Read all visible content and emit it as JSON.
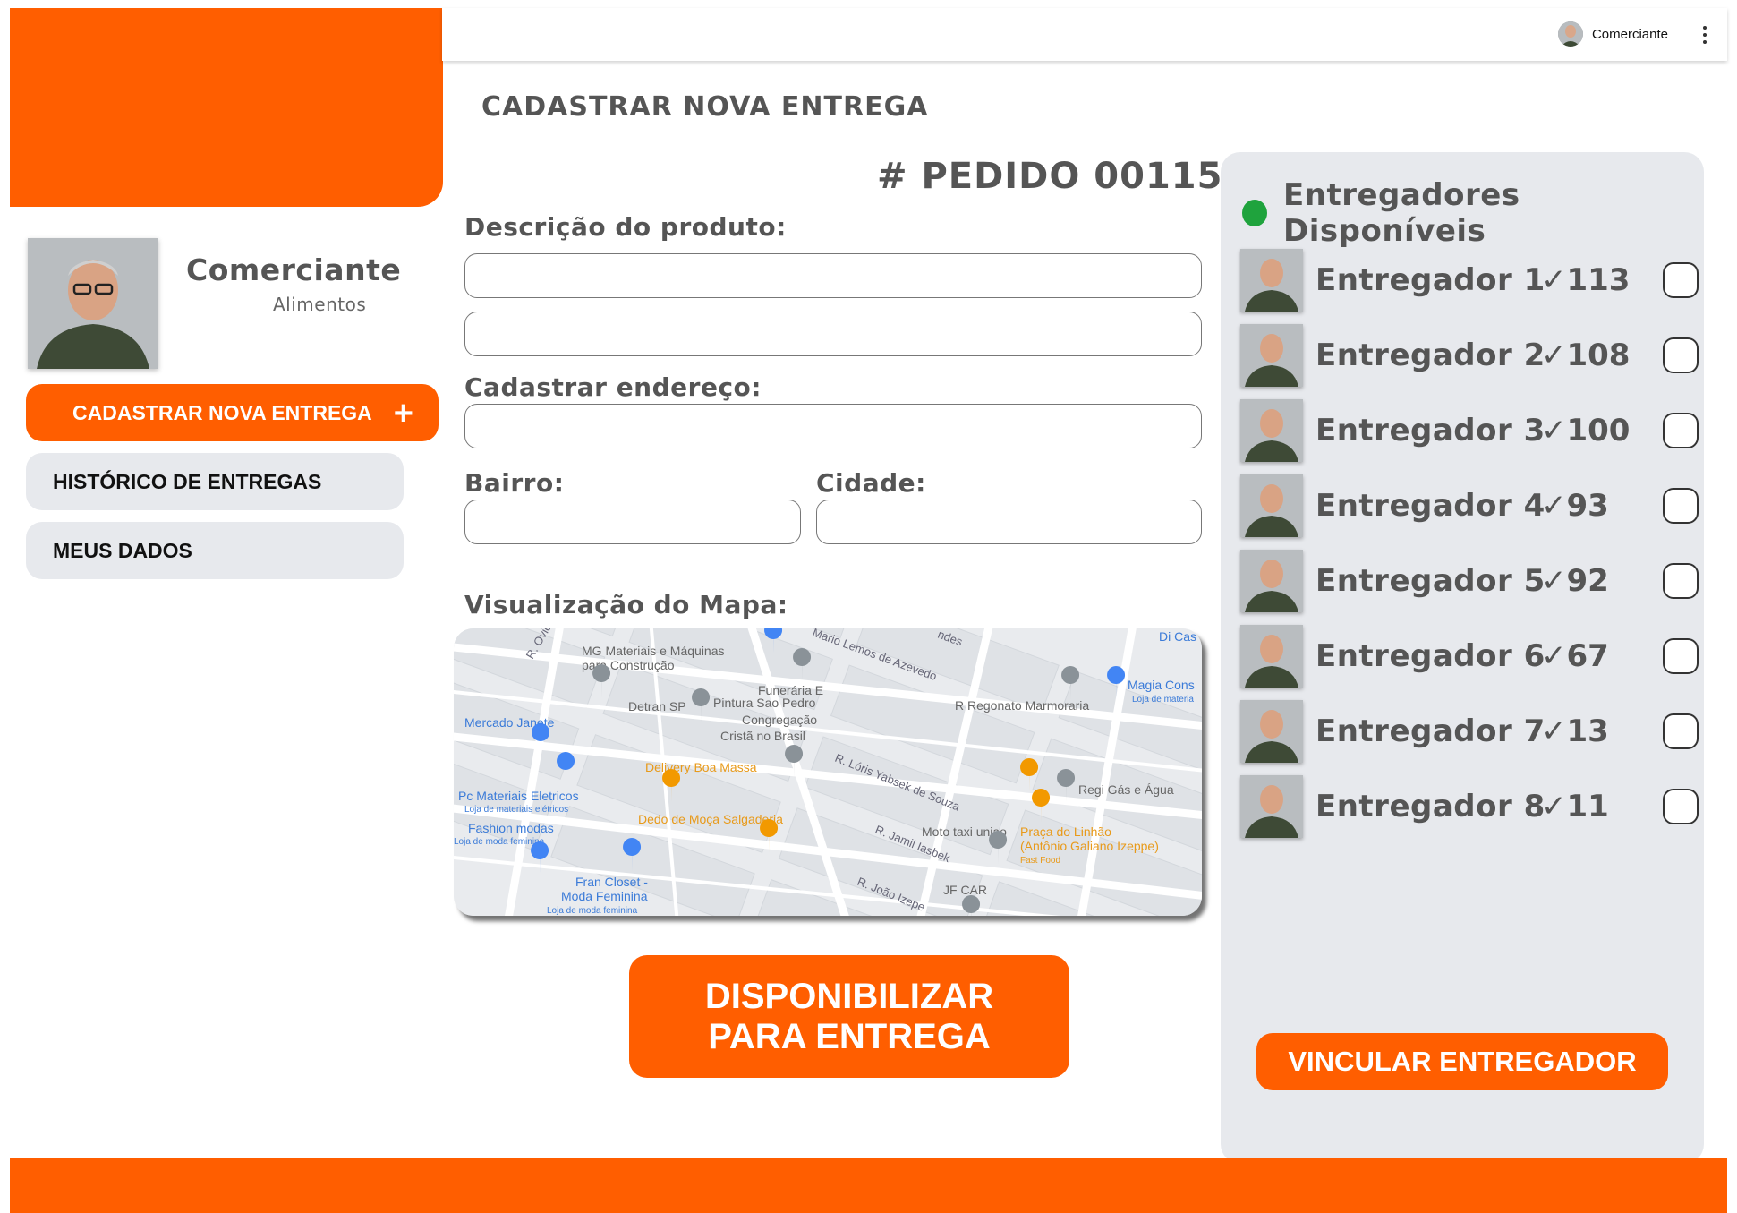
{
  "colors": {
    "accent": "#ff5e00",
    "status_online": "#1fa33d",
    "nav_inactive": "#e7e9ed"
  },
  "topbar": {
    "user_name": "Comerciante",
    "menu_icon": "more-vertical-icon"
  },
  "profile": {
    "name": "Comerciante",
    "category": "Alimentos"
  },
  "sidebar": {
    "items": [
      {
        "label": "CADASTRAR NOVA ENTREGA",
        "icon": "+",
        "active": true
      },
      {
        "label": "HISTÓRICO DE ENTREGAS",
        "active": false
      },
      {
        "label": "MEUS DADOS",
        "active": false
      }
    ]
  },
  "form": {
    "page_title": "CADASTRAR NOVA ENTREGA",
    "order_number": "# PEDIDO 00115",
    "description_label": "Descrição do produto:",
    "address_label": "Cadastrar endereço:",
    "neighborhood_label": "Bairro:",
    "city_label": "Cidade:",
    "map_label": "Visualização do Mapa:",
    "submit_line1": "DISPONIBILIZAR",
    "submit_line2": "PARA ENTREGA"
  },
  "map": {
    "streets": [
      "R. Ovid",
      "Mario Lemos de Azevedo",
      "R. Lóris Yabsek de Souza",
      "R. Jamil Iasbek",
      "R. João Izepe",
      "ndes"
    ],
    "places": [
      {
        "name": "MG Materiais e Máquinas para Construção",
        "kind": "shop"
      },
      {
        "name": "Funerária E",
        "kind": "place"
      },
      {
        "name": "Detran SP",
        "kind": "gov"
      },
      {
        "name": "Pintura Sao Pedro",
        "kind": "place"
      },
      {
        "name": "Congregação Cristã no Brasil",
        "kind": "church"
      },
      {
        "name": "Mercado Janete",
        "kind": "shop"
      },
      {
        "name": "R Regonato Marmoraria",
        "kind": "place"
      },
      {
        "name": "Magia Cons",
        "sub": "Loja de materia",
        "kind": "shop"
      },
      {
        "name": "Di Cas",
        "kind": "shop"
      },
      {
        "name": "Delivery Boa Massa",
        "kind": "food"
      },
      {
        "name": "Regi Gás e Água",
        "kind": "place"
      },
      {
        "name": "Pc Materiais Eletricos",
        "sub": "Loja de materiais elétricos",
        "kind": "shop"
      },
      {
        "name": "Dedo de Moça Salgaderia",
        "kind": "food"
      },
      {
        "name": "Moto taxi uniao",
        "kind": "place"
      },
      {
        "name": "Praça do Linhão (Antônio Galiano Izeppe)",
        "sub": "Fast Food",
        "kind": "food"
      },
      {
        "name": "Fashion modas",
        "sub": "Loja de moda feminina",
        "kind": "shop"
      },
      {
        "name": "Fran Closet - Moda Feminina",
        "sub": "Loja de moda feminina",
        "kind": "shop"
      },
      {
        "name": "JF CAR",
        "kind": "place"
      }
    ]
  },
  "couriers": {
    "title": "Entregadores Disponíveis",
    "items": [
      {
        "name": "Entregador 1",
        "score": "✓113"
      },
      {
        "name": "Entregador 2",
        "score": "✓108"
      },
      {
        "name": "Entregador 3",
        "score": "✓100"
      },
      {
        "name": "Entregador 4",
        "score": "✓93"
      },
      {
        "name": "Entregador 5",
        "score": "✓92"
      },
      {
        "name": "Entregador 6",
        "score": "✓67"
      },
      {
        "name": "Entregador 7",
        "score": "✓13"
      },
      {
        "name": "Entregador 8",
        "score": "✓11"
      }
    ],
    "link_button": "VINCULAR ENTREGADOR"
  }
}
